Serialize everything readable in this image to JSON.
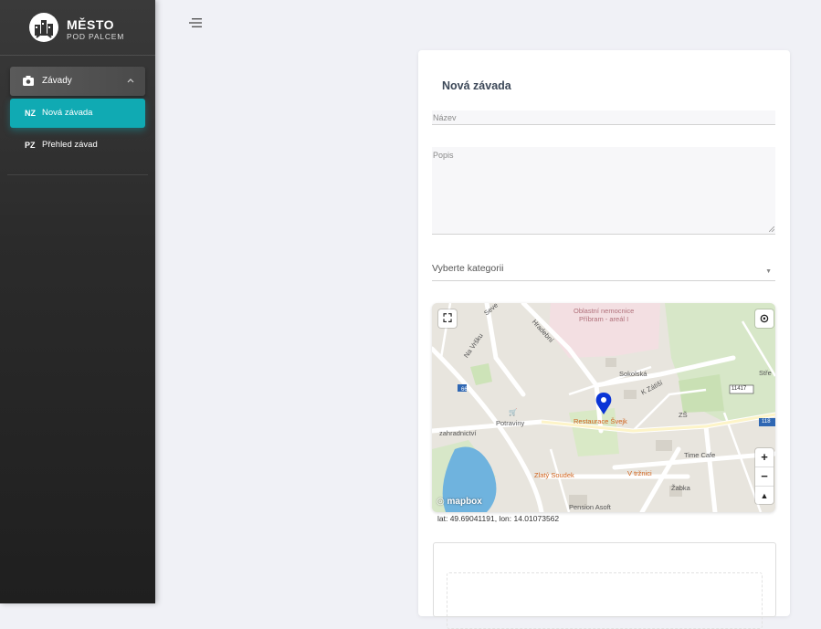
{
  "logo": {
    "title": "MĚSTO",
    "subtitle": "POD PALCEM"
  },
  "sidebar": {
    "group": {
      "label": "Závady",
      "icon": "camera-icon"
    },
    "items": [
      {
        "abbr": "NZ",
        "label": "Nová závada",
        "active": true
      },
      {
        "abbr": "PZ",
        "label": "Přehled závad",
        "active": false
      }
    ]
  },
  "form": {
    "title": "Nová závada",
    "name_label": "Název",
    "description_label": "Popis",
    "category_placeholder": "Vyberte kategorii"
  },
  "map": {
    "labels": {
      "hospital": "Oblastní nemocnice\nPříbram - areál I",
      "street_sokolska": "Sokolská",
      "street_kzasi": "K Zátiší",
      "street_hradebni": "Hradební",
      "street_navrsku": "Na Vršku",
      "street_seve": "Seve",
      "potraviny": "Potraviny",
      "zahradnictvi": "zahradnictví",
      "restaurace": "Restaurace Švejk",
      "zs": "ZŠ",
      "time_cafe": "Time Cafe",
      "zlaty_soudek": "Zlatý Soudek",
      "v_trznici": "V tržnici",
      "zabka": "Žabka",
      "pension": "Pension Asoft",
      "road_66": "66",
      "road_11417": "11417",
      "road_118": "118",
      "stre": "Stře",
      "hotel": "Hotel"
    },
    "attribution": "mapbox",
    "zoom_in": "+",
    "zoom_out": "−",
    "compass": "▲"
  },
  "coords_text": "lat: 49.69041191, lon: 14.01073562"
}
